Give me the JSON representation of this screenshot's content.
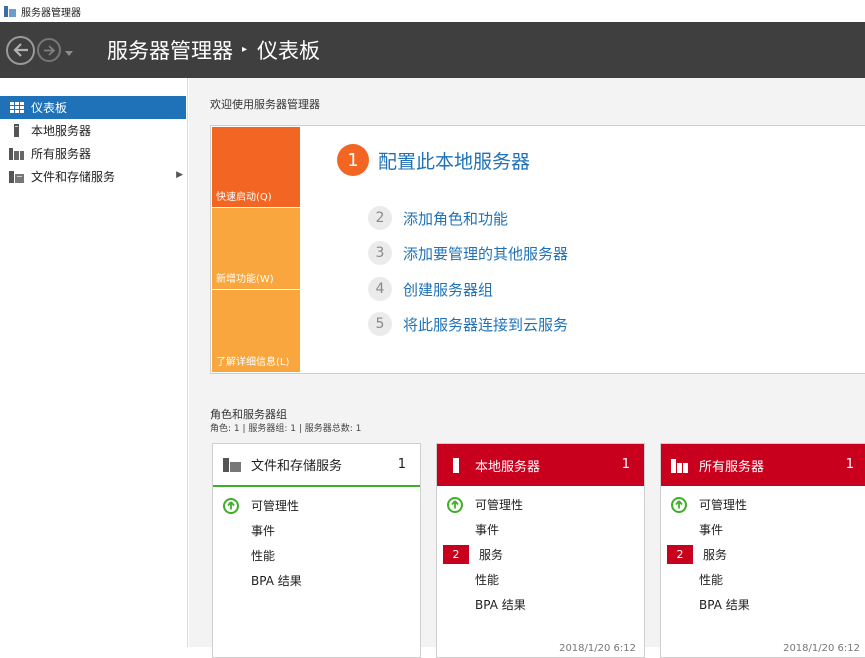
{
  "window": {
    "title": "服务器管理器"
  },
  "header": {
    "app": "服务器管理器",
    "sep": "▸",
    "page": "仪表板"
  },
  "sidebar": {
    "items": [
      {
        "label": "仪表板",
        "icon": "dashboard-icon",
        "active": true
      },
      {
        "label": "本地服务器",
        "icon": "server-icon"
      },
      {
        "label": "所有服务器",
        "icon": "servers-icon"
      },
      {
        "label": "文件和存储服务",
        "icon": "storage-icon",
        "expand": "▶"
      }
    ]
  },
  "welcome": {
    "title": "欢迎使用服务器管理器",
    "quick_tabs": [
      "快速启动(Q)",
      "新增功能(W)",
      "了解详细信息(L)"
    ],
    "main_step": {
      "num": "1",
      "label": "配置此本地服务器"
    },
    "steps": [
      {
        "num": "2",
        "label": "添加角色和功能"
      },
      {
        "num": "3",
        "label": "添加要管理的其他服务器"
      },
      {
        "num": "4",
        "label": "创建服务器组"
      },
      {
        "num": "5",
        "label": "将此服务器连接到云服务"
      }
    ]
  },
  "roles": {
    "title": "角色和服务器组",
    "subtitle": "角色: 1 | 服务器组: 1 | 服务器总数: 1",
    "tiles": [
      {
        "title": "文件和存储服务",
        "count": "1",
        "status": "ok",
        "rows": {
          "manageability": "可管理性",
          "events": "事件",
          "performance": "性能",
          "bpa": "BPA 结果"
        }
      },
      {
        "title": "本地服务器",
        "count": "1",
        "status": "alert",
        "rows": {
          "manageability": "可管理性",
          "events": "事件",
          "services_badge": "2",
          "services": "服务",
          "performance": "性能",
          "bpa": "BPA 结果"
        },
        "timestamp": "2018/1/20 6:12"
      },
      {
        "title": "所有服务器",
        "count": "1",
        "status": "alert",
        "rows": {
          "manageability": "可管理性",
          "events": "事件",
          "services_badge": "2",
          "services": "服务",
          "performance": "性能",
          "bpa": "BPA 结果"
        },
        "timestamp": "2018/1/20 6:12"
      }
    ]
  },
  "colors": {
    "accent": "#1f72b8",
    "header": "#3f3f3f",
    "orange": "#f26522",
    "amber": "#f9a63e",
    "red": "#c8001e",
    "green": "#3fae2a"
  }
}
